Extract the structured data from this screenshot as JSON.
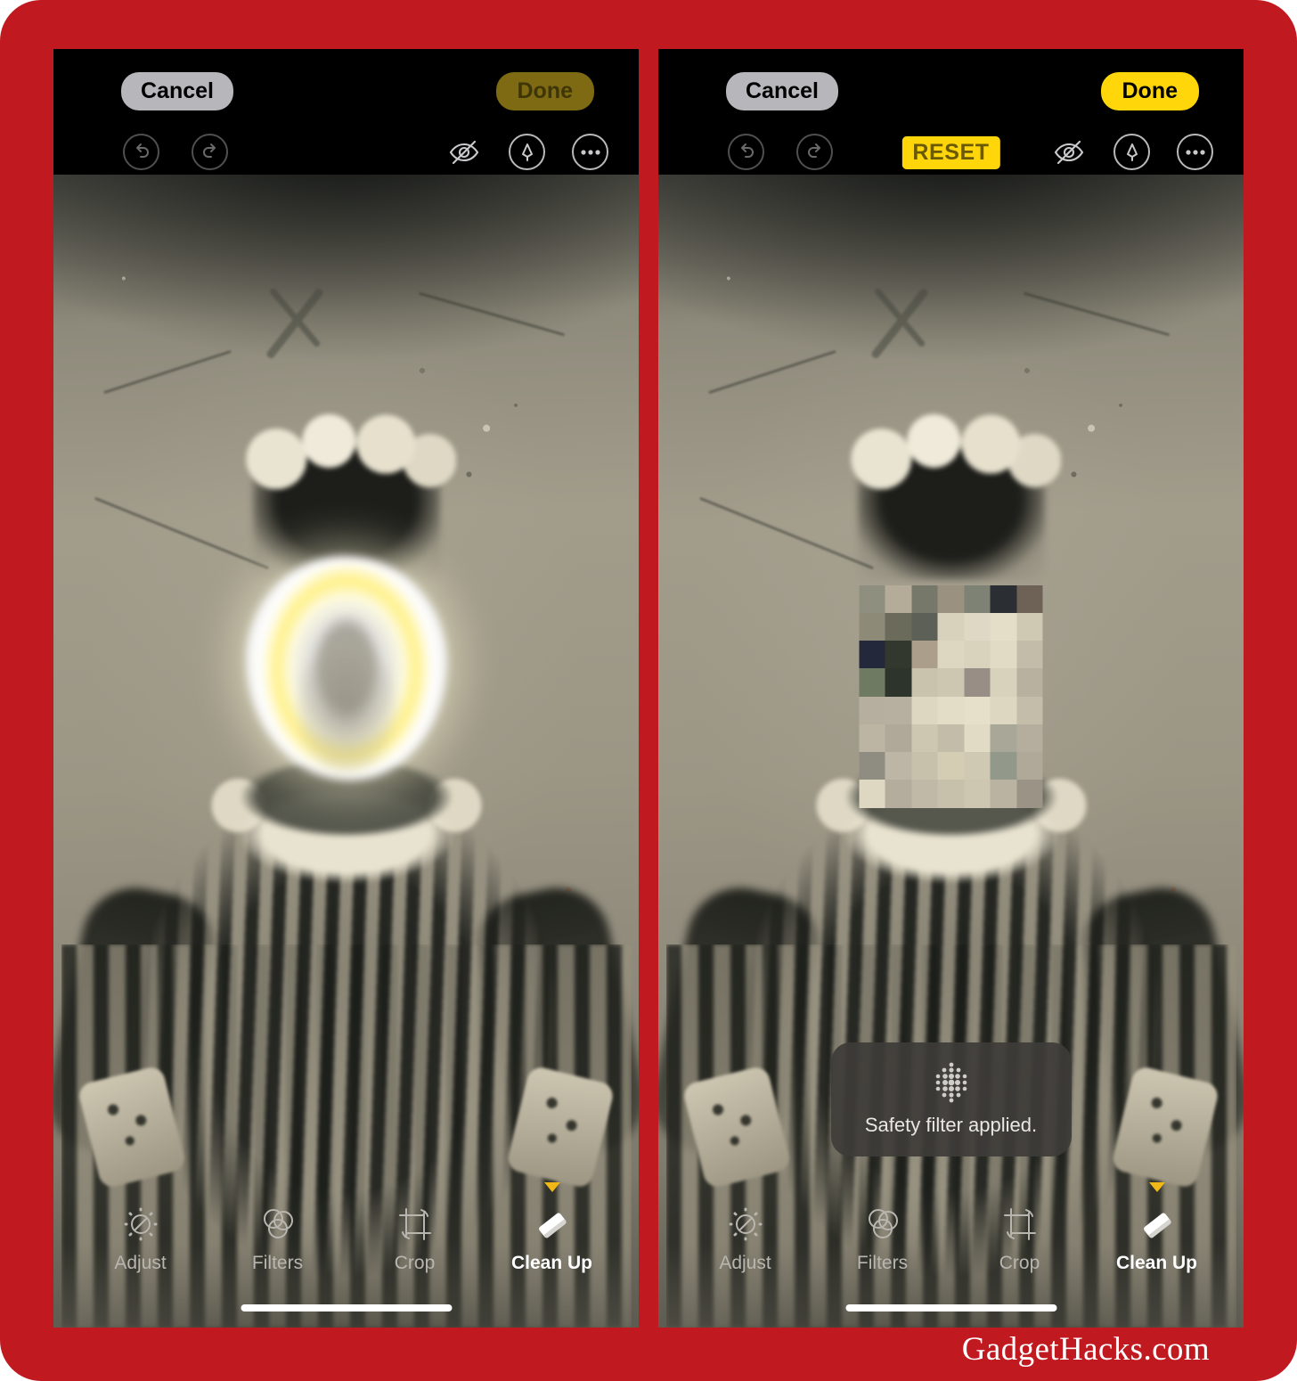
{
  "watermark": "GadgetHacks.com",
  "theme": {
    "frame_red": "#c01a20",
    "accent_yellow": "#ffd60a",
    "done_disabled_bg": "#7d6a12",
    "cancel_bg": "#b6b6bb",
    "caret_yellow": "#f0b719"
  },
  "panels": [
    {
      "id": "before",
      "navbar": {
        "cancel_label": "Cancel",
        "done_label": "Done",
        "done_state": "disabled"
      },
      "toolbar": {
        "undo_icon": "undo-icon",
        "redo_icon": "redo-icon",
        "undo_state": "disabled",
        "redo_state": "disabled",
        "reset_label": null,
        "reset_visible": false,
        "hide_icon": "eye-slash-icon",
        "markup_icon": "markup-pen-icon",
        "more_icon": "more-ellipsis-icon"
      },
      "canvas": {
        "state": "cleanup-processing",
        "overlay": "glowing-ring"
      },
      "toast": null,
      "tools": [
        {
          "label": "Adjust",
          "icon": "adjust-icon",
          "active": false
        },
        {
          "label": "Filters",
          "icon": "filters-icon",
          "active": false
        },
        {
          "label": "Crop",
          "icon": "crop-icon",
          "active": false
        },
        {
          "label": "Clean Up",
          "icon": "eraser-icon",
          "active": true
        }
      ]
    },
    {
      "id": "after",
      "navbar": {
        "cancel_label": "Cancel",
        "done_label": "Done",
        "done_state": "enabled"
      },
      "toolbar": {
        "undo_icon": "undo-icon",
        "redo_icon": "redo-icon",
        "undo_state": "disabled",
        "redo_state": "disabled",
        "reset_label": "RESET",
        "reset_visible": true,
        "hide_icon": "eye-slash-icon",
        "markup_icon": "markup-pen-icon",
        "more_icon": "more-ellipsis-icon"
      },
      "canvas": {
        "state": "safety-filtered",
        "overlay": "pixelated-face"
      },
      "toast": {
        "icon": "sparkle-dots-icon",
        "message": "Safety filter applied."
      },
      "tools": [
        {
          "label": "Adjust",
          "icon": "adjust-icon",
          "active": false
        },
        {
          "label": "Filters",
          "icon": "filters-icon",
          "active": false
        },
        {
          "label": "Crop",
          "icon": "crop-icon",
          "active": false
        },
        {
          "label": "Clean Up",
          "icon": "eraser-icon",
          "active": true
        }
      ]
    }
  ],
  "pixel_mosaic": [
    "#8e8f7f",
    "#b4ab99",
    "#76786a",
    "#9a9181",
    "#7d8274",
    "#2b2f33",
    "#6e6257",
    "#8e8a78",
    "#6a6b5b",
    "#5d6057",
    "#d8d2bd",
    "#ded8c4",
    "#e4ddc8",
    "#cfc8b3",
    "#23293a",
    "#33382f",
    "#ab9f8c",
    "#ddd7c2",
    "#d9d2bd",
    "#e1dac5",
    "#c3bca8",
    "#6f7a63",
    "#2d342c",
    "#c9c3ae",
    "#cdc7b2",
    "#988e85",
    "#d8d1bc",
    "#b8b1a0",
    "#b6afa0",
    "#b7b0a0",
    "#ddd6c1",
    "#e3dcc7",
    "#e6dfca",
    "#ddd6c1",
    "#c4bda9",
    "#bcb5a3",
    "#b0a99a",
    "#cdc6b1",
    "#c3bca8",
    "#e1dac5",
    "#a9a898",
    "#b5ae9e",
    "#8f8d82",
    "#bdb6a6",
    "#c7c0ab",
    "#d5ccb4",
    "#cfc8b3",
    "#93998a",
    "#b0a99a",
    "#ded7c2",
    "#b4ad9d",
    "#c0b9a8",
    "#c7c0ab",
    "#cdc6b1",
    "#bab3a2",
    "#9b9486",
    "#c3bca8",
    "#a8a192",
    "#b1aa9a",
    "#bdb6a6",
    "#9e9789",
    "#7c7f74",
    "#8c857a",
    "#a7a091"
  ]
}
